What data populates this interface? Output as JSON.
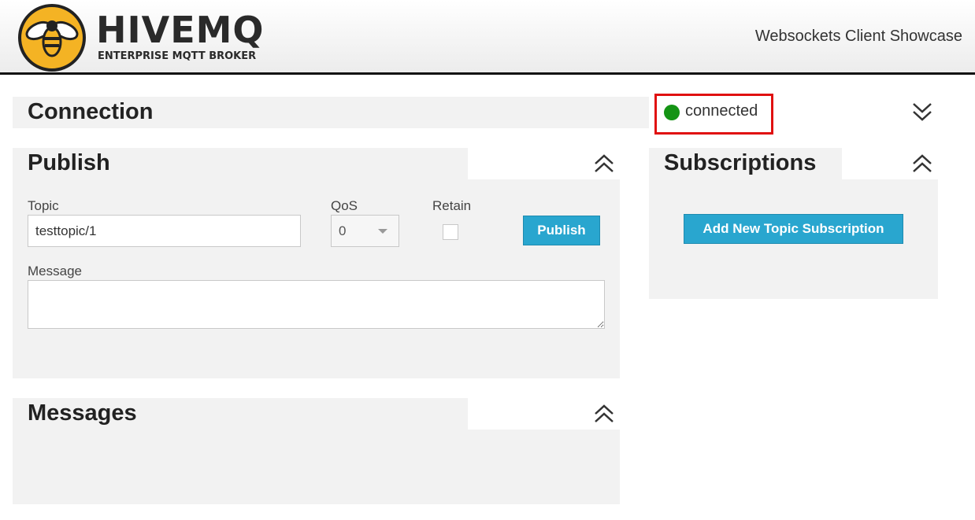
{
  "header": {
    "logo_text": "HIVEMQ",
    "logo_sub": "ENTERPRISE MQTT BROKER",
    "showcase": "Websockets Client Showcase"
  },
  "connection": {
    "title": "Connection",
    "status": "connected",
    "status_color": "#149414",
    "toggle_icon": "chevron-double-down-icon"
  },
  "publish": {
    "title": "Publish",
    "topic_label": "Topic",
    "topic_value": "testtopic/1",
    "qos_label": "QoS",
    "qos_value": "0",
    "retain_label": "Retain",
    "publish_button": "Publish",
    "message_label": "Message",
    "message_value": "",
    "toggle_icon": "chevron-double-up-icon"
  },
  "subscriptions": {
    "title": "Subscriptions",
    "add_button": "Add New Topic Subscription",
    "toggle_icon": "chevron-double-up-icon"
  },
  "messages": {
    "title": "Messages",
    "toggle_icon": "chevron-double-up-icon"
  },
  "colors": {
    "accent": "#29a6cf",
    "highlight_border": "#e01010",
    "logo": "#f4b324"
  }
}
